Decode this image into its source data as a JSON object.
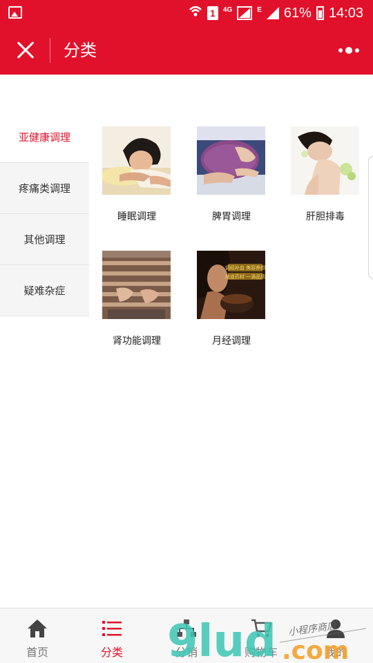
{
  "status_bar": {
    "sim_slot": "1",
    "network_type": "4G",
    "network_type_2": "E",
    "battery": "61%",
    "time": "14:03"
  },
  "header": {
    "title": "分类"
  },
  "sidebar": {
    "items": [
      {
        "label": "亚健康调理",
        "active": true
      },
      {
        "label": "疼痛类调理",
        "active": false
      },
      {
        "label": "其他调理",
        "active": false
      },
      {
        "label": "疑难杂症",
        "active": false
      }
    ]
  },
  "categories": [
    {
      "label": "睡眠调理",
      "image": "sleeping-woman-photo"
    },
    {
      "label": "脾胃调理",
      "image": "hot-water-bottle-photo"
    },
    {
      "label": "肝胆排毒",
      "image": "spa-woman-photo"
    },
    {
      "label": "肾功能调理",
      "image": "back-massage-photo"
    },
    {
      "label": "月经调理",
      "image": "tea-woman-photo",
      "poster_text": [
        "调经补血 美容养颜",
        "地道药材 一滴品质"
      ]
    }
  ],
  "tabbar": {
    "items": [
      {
        "label": "首页",
        "icon": "home-icon",
        "active": false
      },
      {
        "label": "分类",
        "icon": "list-icon",
        "active": true
      },
      {
        "label": "分销",
        "icon": "sitemap-icon",
        "active": false
      },
      {
        "label": "购物车",
        "icon": "cart-icon",
        "active": false
      },
      {
        "label": "我的",
        "icon": "user-icon",
        "active": false
      }
    ]
  },
  "watermark": {
    "brand": "9lud",
    "domain": ".com",
    "tagline": "小程序商店"
  },
  "colors": {
    "brand_red": "#e2112b",
    "watermark_teal": "#3cc6b4",
    "watermark_orange": "#f3a02b"
  }
}
